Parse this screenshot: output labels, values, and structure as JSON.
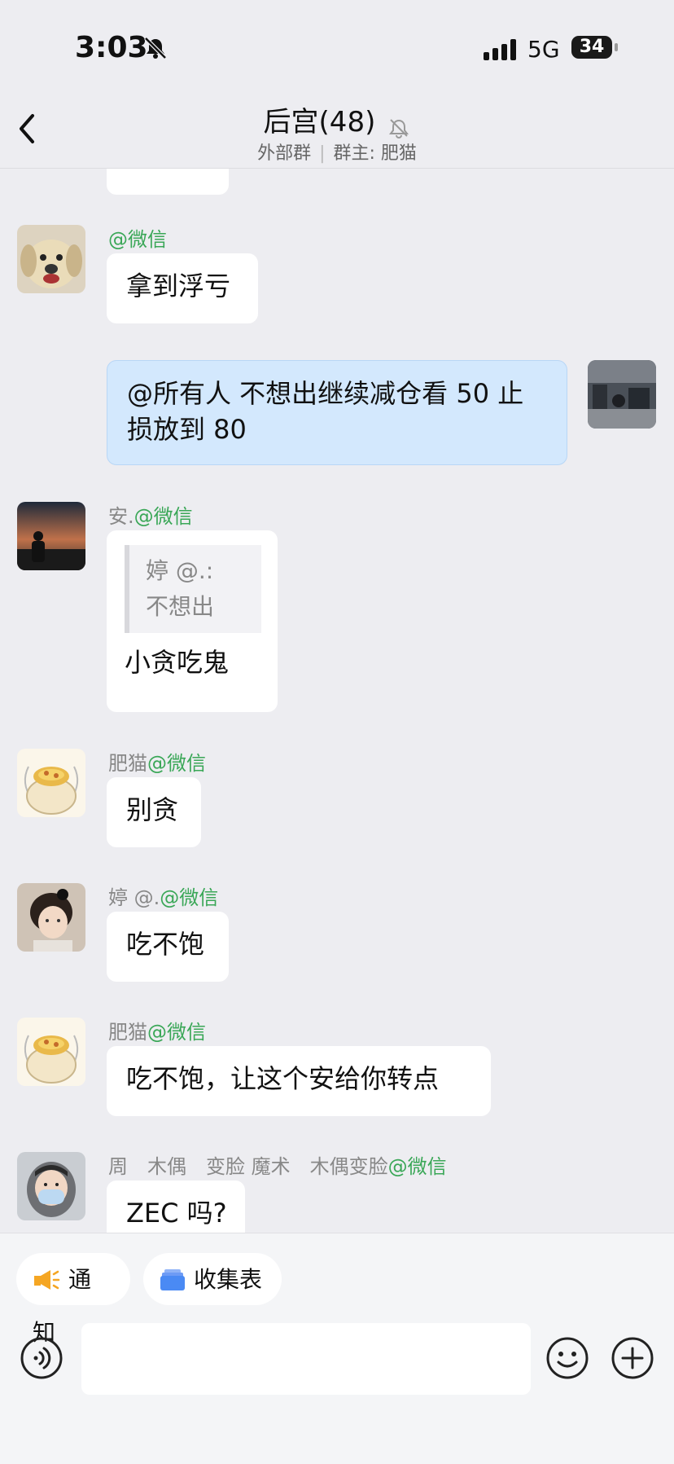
{
  "status_bar": {
    "time": "3:03",
    "network": "5G",
    "battery": "34"
  },
  "header": {
    "title": "后宫(48)",
    "group_type": "外部群",
    "owner": "群主: 肥猫"
  },
  "messages": [
    {
      "sender": "",
      "source": "@微信",
      "text": "拿到浮亏"
    },
    {
      "self": true,
      "text": "@所有人 不想出继续减仓看 50 止损放到 80"
    },
    {
      "sender": "安.",
      "source": "@微信",
      "quote_author": "婷 @.:",
      "quote_text": "不想出",
      "text": "小贪吃鬼"
    },
    {
      "sender": "肥猫",
      "source": "@微信",
      "text": "别贪"
    },
    {
      "sender": "婷 @.",
      "source": "@微信",
      "text": "吃不饱"
    },
    {
      "sender": "肥猫",
      "source": "@微信",
      "text": "吃不饱，让这个安给你转点"
    },
    {
      "sender": "周　木偶　变脸 魔术　木偶变脸",
      "source": "@微信",
      "text": "ZEC 吗?"
    }
  ],
  "toolbar": {
    "notice_label": "通知",
    "form_label": "收集表"
  },
  "input": {
    "placeholder": ""
  },
  "icons": {
    "back": "chevron-left-icon",
    "mute": "bell-slash-icon",
    "voice": "voice-input-icon",
    "emoji": "emoji-icon",
    "more": "plus-circle-icon",
    "notice": "megaphone-icon",
    "form": "form-stack-icon"
  },
  "colors": {
    "wechat_tag": "#3aa757",
    "self_bubble": "#d3e8fd",
    "notice_icon": "#f5a623",
    "form_icon": "#4a8af4"
  }
}
